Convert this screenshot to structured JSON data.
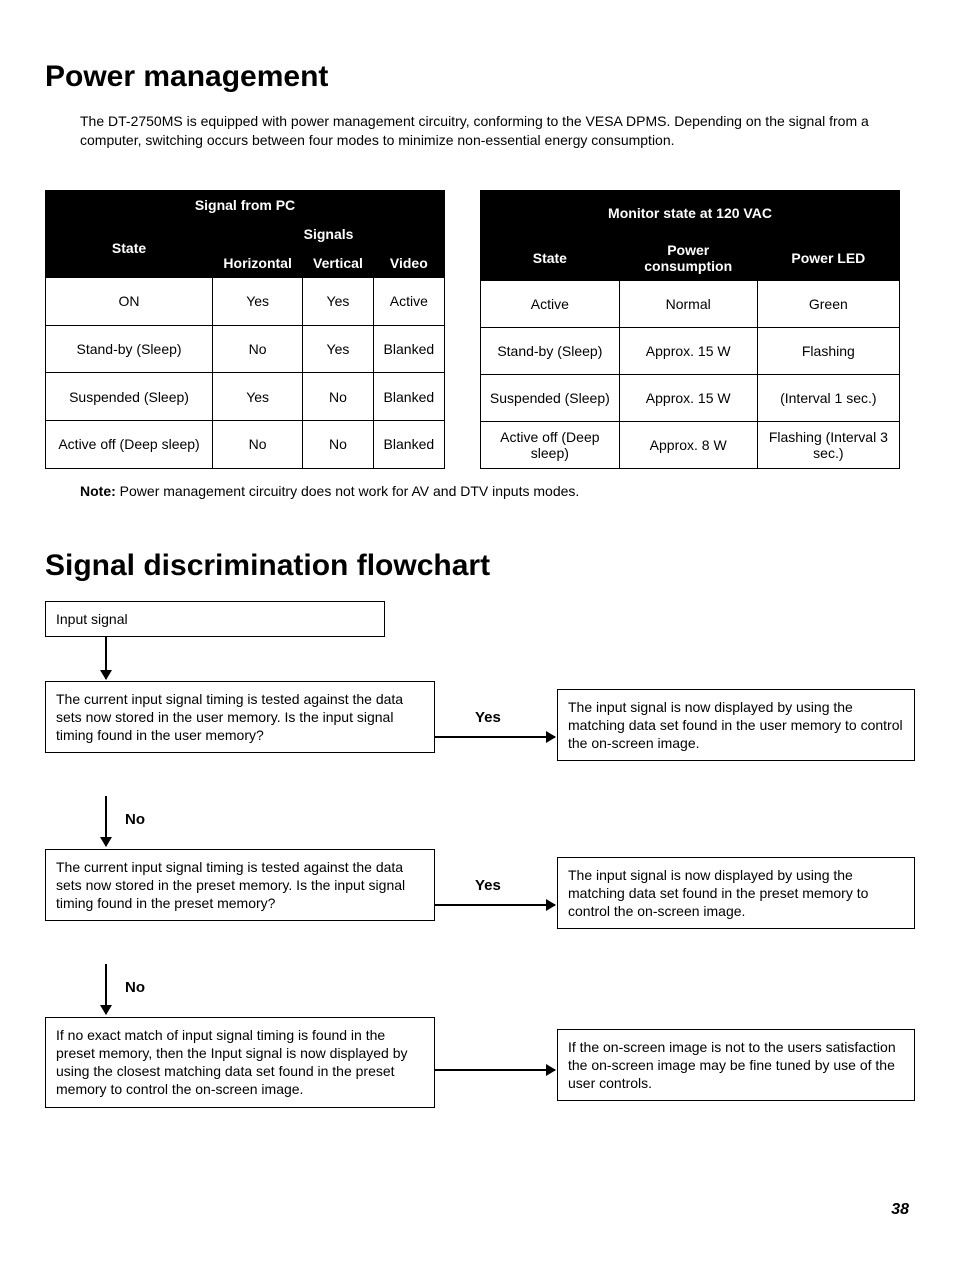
{
  "heading1": "Power management",
  "intro": "The DT-2750MS is equipped with power management circuitry, conforming to the VESA DPMS. Depending on the signal from a computer, switching occurs between four modes to minimize non-essential energy consumption.",
  "table1": {
    "caption_top": "Signal from PC",
    "col_state": "State",
    "col_signals": "Signals",
    "col_h": "Horizontal",
    "col_v": "Vertical",
    "col_video": "Video",
    "rows": [
      {
        "state": "ON",
        "h": "Yes",
        "v": "Yes",
        "video": "Active"
      },
      {
        "state": "Stand-by (Sleep)",
        "h": "No",
        "v": "Yes",
        "video": "Blanked"
      },
      {
        "state": "Suspended (Sleep)",
        "h": "Yes",
        "v": "No",
        "video": "Blanked"
      },
      {
        "state": "Active off (Deep sleep)",
        "h": "No",
        "v": "No",
        "video": "Blanked"
      }
    ]
  },
  "table2": {
    "caption_top": "Monitor state at 120 VAC",
    "col_state": "State",
    "col_pow": "Power consumption",
    "col_led": "Power LED",
    "rows": [
      {
        "state": "Active",
        "pow": "Normal",
        "led": "Green"
      },
      {
        "state": "Stand-by (Sleep)",
        "pow": "Approx. 15 W",
        "led": "Flashing"
      },
      {
        "state": "Suspended (Sleep)",
        "pow": "Approx. 15 W",
        "led": "(Interval 1 sec.)"
      },
      {
        "state": "Active off (Deep sleep)",
        "pow": "Approx.  8 W",
        "led": "Flashing (Interval 3 sec.)"
      }
    ]
  },
  "note_label": "Note: ",
  "note_text": "Power management circuitry does not work for AV and DTV inputs modes.",
  "heading2": "Signal discrimination flowchart",
  "flow": {
    "b1": "Input signal",
    "b2": "The current input signal timing is tested against the data sets now stored in the user memory.\nIs the input signal timing found in the user memory?",
    "b3": "The input signal is now displayed by using the matching data set found in the user memory to control the on-screen image.",
    "b4": "The current input signal timing is tested against the data sets now stored in the preset memory.\nIs the input signal timing found in the preset memory?",
    "b5": "The input signal is now displayed by using the matching data set found in the preset memory to control the on-screen image.",
    "b6": "If no exact match of input signal timing is found in the preset memory, then the Input signal is now displayed by using the closest matching data set found in the preset memory to control the on-screen image.",
    "b7": "If the on-screen image is not to the users satisfaction the on-screen image may be fine tuned by use of the user controls.",
    "yes": "Yes",
    "no": "No"
  },
  "page": "38"
}
